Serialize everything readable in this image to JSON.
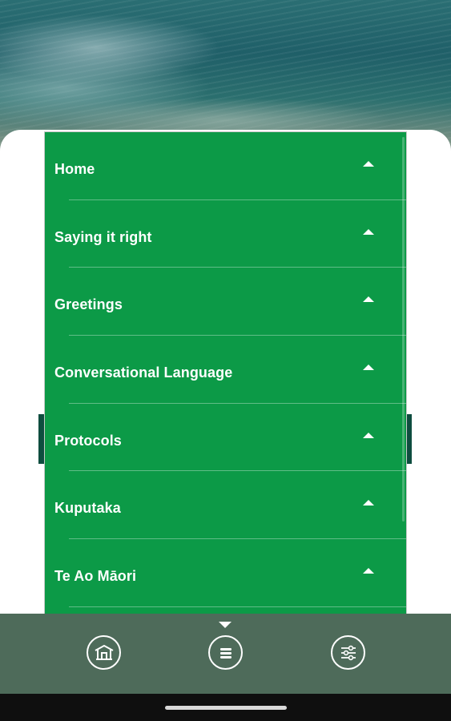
{
  "menu": {
    "items": [
      {
        "label": "Home"
      },
      {
        "label": "Saying it right"
      },
      {
        "label": "Greetings"
      },
      {
        "label": "Conversational Language"
      },
      {
        "label": "Protocols"
      },
      {
        "label": "Kuputaka"
      },
      {
        "label": "Te Ao Māori"
      }
    ]
  },
  "bottom_nav": {
    "items": [
      {
        "icon": "marae-icon"
      },
      {
        "icon": "menu-icon",
        "active": true
      },
      {
        "icon": "sliders-icon"
      }
    ]
  },
  "colors": {
    "menu_green": "#0c9a47",
    "nav_bar": "#4e6b5a",
    "ocean": "#1f5f68"
  }
}
